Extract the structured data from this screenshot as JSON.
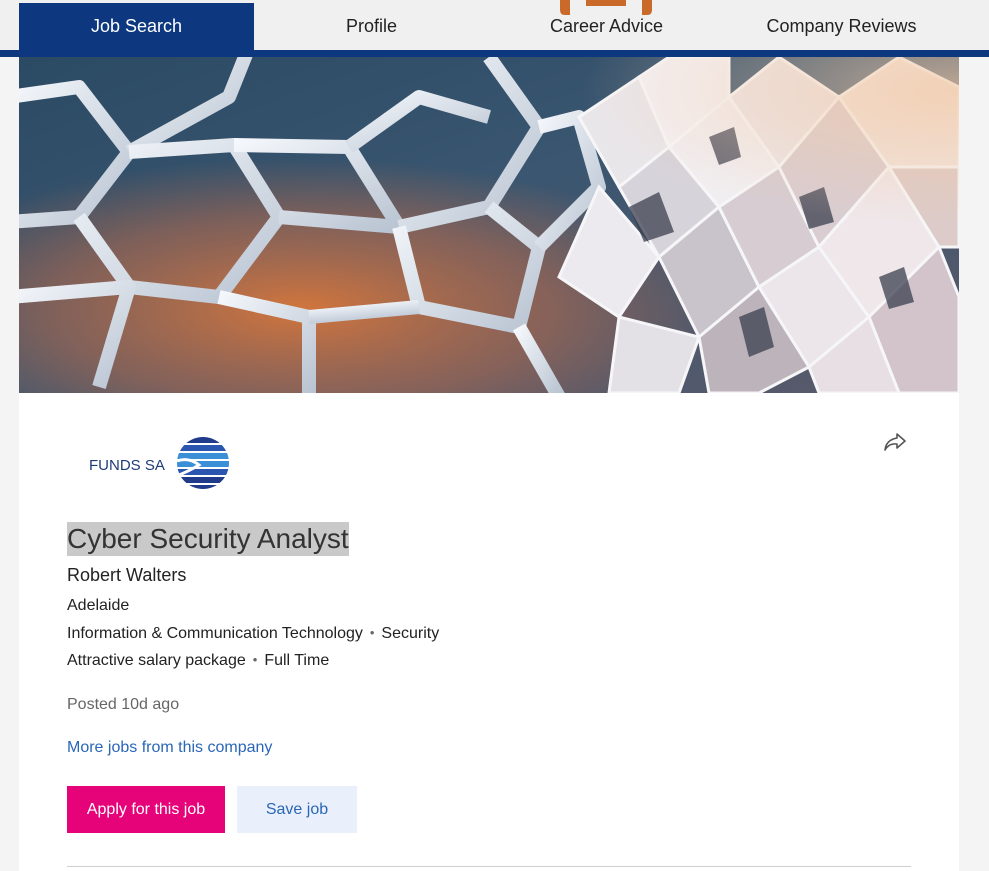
{
  "nav": {
    "tabs": [
      {
        "label": "Job Search",
        "active": true
      },
      {
        "label": "Profile",
        "active": false
      },
      {
        "label": "Career Advice",
        "active": false
      },
      {
        "label": "Company Reviews",
        "active": false
      }
    ]
  },
  "colors": {
    "nav_active": "#0d3880",
    "apply_button": "#e60278",
    "link": "#2a66b8",
    "save_button_bg": "#eaf0fb"
  },
  "advertiser": {
    "logo_text": "FUNDS SA"
  },
  "job": {
    "title": "Cyber Security Analyst",
    "company": "Robert Walters",
    "location": "Adelaide",
    "classification": "Information & Communication Technology",
    "subclassification": "Security",
    "salary": "Attractive salary package",
    "work_type": "Full Time",
    "posted": "Posted 10d ago",
    "more_jobs_link": "More jobs from this company"
  },
  "actions": {
    "apply_label": "Apply for this job",
    "save_label": "Save job"
  },
  "icons": {
    "share": "share-arrow-icon"
  }
}
